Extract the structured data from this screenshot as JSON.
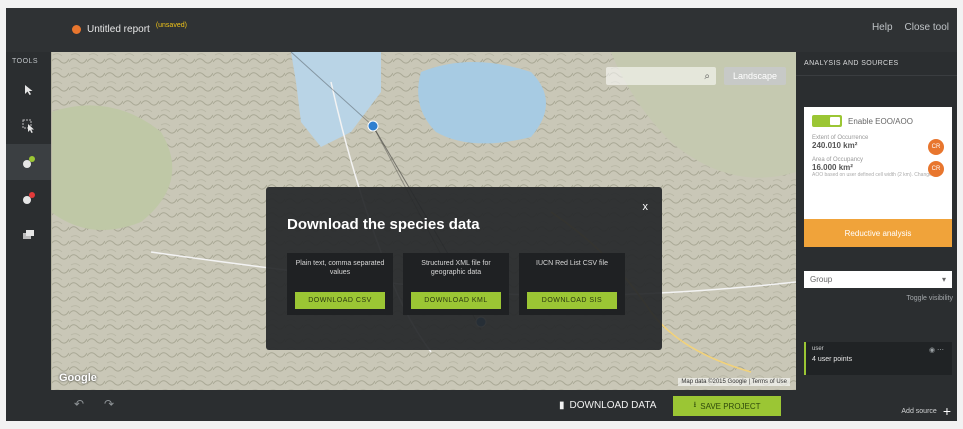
{
  "header": {
    "title": "Untitled report",
    "status": "(unsaved)",
    "links": [
      "Help",
      "Close tool"
    ]
  },
  "tools": {
    "label": "TOOLS",
    "items": [
      "select-arrow-icon",
      "select-box-icon",
      "add-point-icon",
      "remove-point-icon",
      "layers-icon"
    ]
  },
  "map": {
    "search_icon": "search-icon",
    "layer_label": "Landscape",
    "google_label": "Google",
    "attribution": "Map data ©2015 Google | Terms of Use"
  },
  "modal": {
    "title": "Download the species data",
    "close": "x",
    "options": [
      {
        "desc": "Plain text, comma separated values",
        "button": "DOWNLOAD CSV"
      },
      {
        "desc": "Structured XML file for geographic data",
        "button": "DOWNLOAD KML"
      },
      {
        "desc": "IUCN Red List CSV file",
        "button": "DOWNLOAD SIS"
      }
    ]
  },
  "right": {
    "header": "ANALYSIS AND SOURCES",
    "card": {
      "toggle_label": "Enable EOO/AOO",
      "eoo_label": "Extent of Occurrence",
      "eoo_value": "240.010 km²",
      "eoo_badge": "CR",
      "aoo_label": "Area of Occupancy",
      "aoo_value": "16.000 km²",
      "aoo_badge": "CR",
      "aoo_note": "AOO based on user defined cell width (2 km). Change",
      "reduce_label": "Reductive analysis"
    },
    "group_select": "Group",
    "toggle_visibility": "Toggle visibility",
    "group_item": {
      "name": "user",
      "count": "4 user points"
    },
    "add_source": "Add source"
  },
  "footer": {
    "download_data": "DOWNLOAD DATA",
    "save_project": "SAVE PROJECT"
  },
  "colors": {
    "accent_green": "#9bc634",
    "accent_orange": "#e8762e",
    "dark_bg": "#2b2e30"
  }
}
